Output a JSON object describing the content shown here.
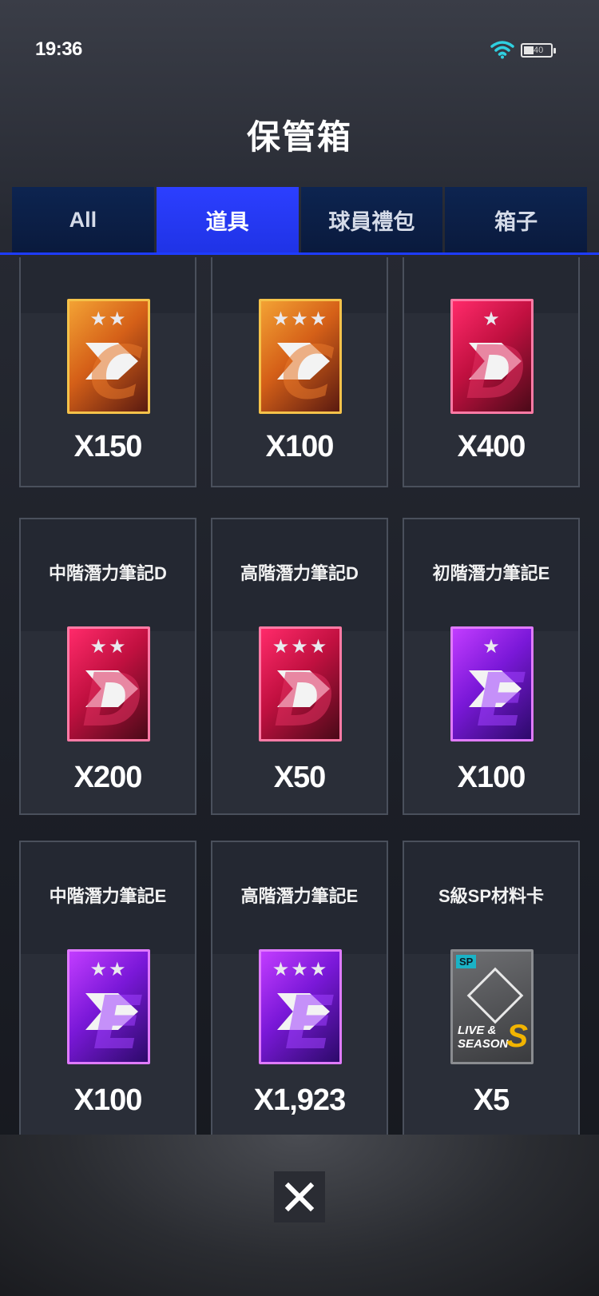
{
  "status": {
    "time": "19:36",
    "battery": "40"
  },
  "title": "保管箱",
  "tabs": [
    {
      "label": "All",
      "active": false
    },
    {
      "label": "道具",
      "active": true
    },
    {
      "label": "球員禮包",
      "active": false
    },
    {
      "label": "箱子",
      "active": false
    }
  ],
  "items": [
    {
      "name": "",
      "quantity": "X150",
      "icon": "potential-note-c-2star-icon",
      "tier": "C",
      "stars": 2
    },
    {
      "name": "",
      "quantity": "X100",
      "icon": "potential-note-c-3star-icon",
      "tier": "C",
      "stars": 3
    },
    {
      "name": "",
      "quantity": "X400",
      "icon": "potential-note-d-1star-icon",
      "tier": "D",
      "stars": 1
    },
    {
      "name": "中階潛力筆記D",
      "quantity": "X200",
      "icon": "potential-note-d-2star-icon",
      "tier": "D",
      "stars": 2
    },
    {
      "name": "高階潛力筆記D",
      "quantity": "X50",
      "icon": "potential-note-d-3star-icon",
      "tier": "D",
      "stars": 3
    },
    {
      "name": "初階潛力筆記E",
      "quantity": "X100",
      "icon": "potential-note-e-1star-icon",
      "tier": "E",
      "stars": 1
    },
    {
      "name": "中階潛力筆記E",
      "quantity": "X100",
      "icon": "potential-note-e-2star-icon",
      "tier": "E",
      "stars": 2
    },
    {
      "name": "高階潛力筆記E",
      "quantity": "X1,923",
      "icon": "potential-note-e-3star-icon",
      "tier": "E",
      "stars": 3
    },
    {
      "name": "S級SP材料卡",
      "quantity": "X5",
      "icon": "sp-material-card-icon",
      "tier": "SP",
      "stars": 0,
      "card_text": {
        "badge": "SP",
        "line1": "LIVE &",
        "line2": "SEASON",
        "grade": "S"
      }
    }
  ],
  "close_icon": "close-x-icon"
}
